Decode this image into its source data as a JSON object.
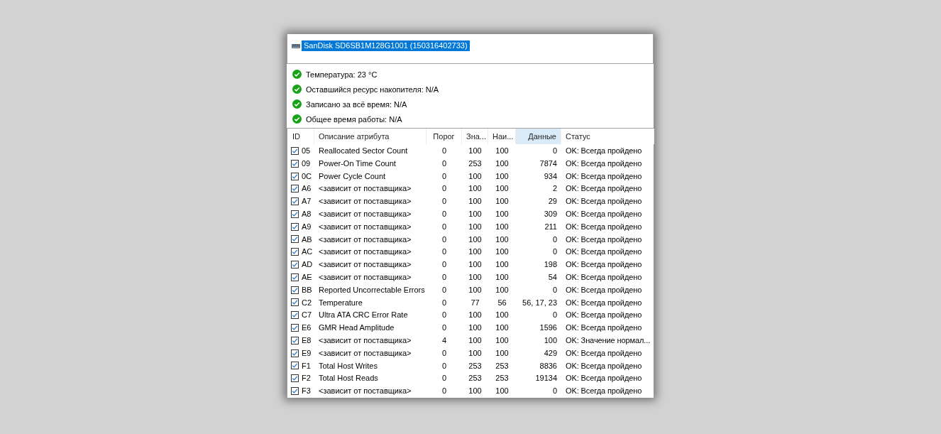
{
  "device_list": {
    "items": [
      {
        "label": "SanDisk SD6SB1M128G1001 (150316402733)",
        "selected": true
      }
    ]
  },
  "health": [
    {
      "text": "Температура: 23 °C",
      "ok": true
    },
    {
      "text": "Оставшийся ресурс накопителя: N/A",
      "ok": true
    },
    {
      "text": "Записано за всё время: N/A",
      "ok": true
    },
    {
      "text": "Общее время работы: N/A",
      "ok": true
    }
  ],
  "table": {
    "columns": [
      {
        "label": "ID",
        "sorted": false
      },
      {
        "label": "Описание атрибута",
        "sorted": false
      },
      {
        "label": "Порог",
        "sorted": false
      },
      {
        "label": "Зна...",
        "sorted": false
      },
      {
        "label": "Наи...",
        "sorted": false
      },
      {
        "label": "Данные",
        "sorted": true
      },
      {
        "label": "Статус",
        "sorted": false
      }
    ],
    "rows": [
      {
        "checked": true,
        "cells": [
          "05",
          "Reallocated Sector Count",
          "0",
          "100",
          "100",
          "0",
          "OK: Всегда пройдено"
        ]
      },
      {
        "checked": true,
        "cells": [
          "09",
          "Power-On Time Count",
          "0",
          "253",
          "100",
          "7874",
          "OK: Всегда пройдено"
        ]
      },
      {
        "checked": true,
        "cells": [
          "0C",
          "Power Cycle Count",
          "0",
          "100",
          "100",
          "934",
          "OK: Всегда пройдено"
        ]
      },
      {
        "checked": true,
        "cells": [
          "A6",
          "<зависит от поставщика>",
          "0",
          "100",
          "100",
          "2",
          "OK: Всегда пройдено"
        ]
      },
      {
        "checked": true,
        "cells": [
          "A7",
          "<зависит от поставщика>",
          "0",
          "100",
          "100",
          "29",
          "OK: Всегда пройдено"
        ]
      },
      {
        "checked": true,
        "cells": [
          "A8",
          "<зависит от поставщика>",
          "0",
          "100",
          "100",
          "309",
          "OK: Всегда пройдено"
        ]
      },
      {
        "checked": true,
        "cells": [
          "A9",
          "<зависит от поставщика>",
          "0",
          "100",
          "100",
          "211",
          "OK: Всегда пройдено"
        ]
      },
      {
        "checked": true,
        "cells": [
          "AB",
          "<зависит от поставщика>",
          "0",
          "100",
          "100",
          "0",
          "OK: Всегда пройдено"
        ]
      },
      {
        "checked": true,
        "cells": [
          "AC",
          "<зависит от поставщика>",
          "0",
          "100",
          "100",
          "0",
          "OK: Всегда пройдено"
        ]
      },
      {
        "checked": true,
        "cells": [
          "AD",
          "<зависит от поставщика>",
          "0",
          "100",
          "100",
          "198",
          "OK: Всегда пройдено"
        ]
      },
      {
        "checked": true,
        "cells": [
          "AE",
          "<зависит от поставщика>",
          "0",
          "100",
          "100",
          "54",
          "OK: Всегда пройдено"
        ]
      },
      {
        "checked": true,
        "cells": [
          "BB",
          "Reported Uncorrectable Errors",
          "0",
          "100",
          "100",
          "0",
          "OK: Всегда пройдено"
        ]
      },
      {
        "checked": true,
        "cells": [
          "C2",
          "Temperature",
          "0",
          "77",
          "56",
          "56, 17, 23",
          "OK: Всегда пройдено"
        ]
      },
      {
        "checked": true,
        "cells": [
          "C7",
          "Ultra ATA CRC Error Rate",
          "0",
          "100",
          "100",
          "0",
          "OK: Всегда пройдено"
        ]
      },
      {
        "checked": true,
        "cells": [
          "E6",
          "GMR Head Amplitude",
          "0",
          "100",
          "100",
          "1596",
          "OK: Всегда пройдено"
        ]
      },
      {
        "checked": true,
        "cells": [
          "E8",
          "<зависит от поставщика>",
          "4",
          "100",
          "100",
          "100",
          "OK: Значение нормал..."
        ]
      },
      {
        "checked": true,
        "cells": [
          "E9",
          "<зависит от поставщика>",
          "0",
          "100",
          "100",
          "429",
          "OK: Всегда пройдено"
        ]
      },
      {
        "checked": true,
        "cells": [
          "F1",
          "Total Host Writes",
          "0",
          "253",
          "253",
          "8836",
          "OK: Всегда пройдено"
        ]
      },
      {
        "checked": true,
        "cells": [
          "F2",
          "Total Host Reads",
          "0",
          "253",
          "253",
          "19134",
          "OK: Всегда пройдено"
        ]
      },
      {
        "checked": true,
        "cells": [
          "F3",
          "<зависит от поставщика>",
          "0",
          "100",
          "100",
          "0",
          "OK: Всегда пройдено"
        ]
      }
    ]
  }
}
